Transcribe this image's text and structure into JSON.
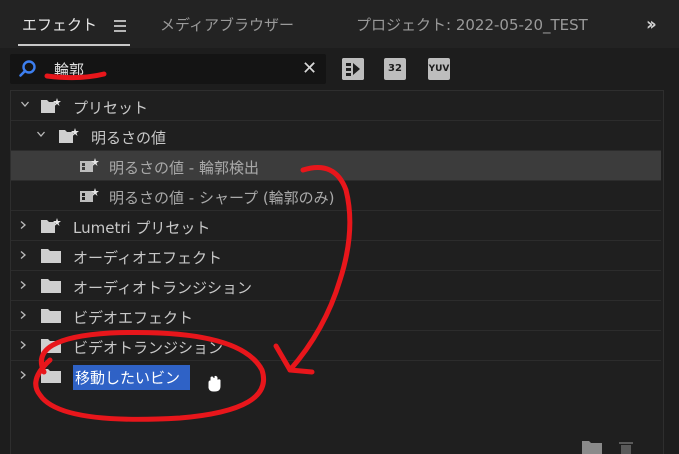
{
  "tabs": {
    "effects": "エフェクト",
    "media_browser": "メディアブラウザー",
    "project": "プロジェクト: 2022-05-20_TEST"
  },
  "search": {
    "value": "輪郭"
  },
  "toolbar": {
    "accelerated_label": "",
    "bit32_label": "32",
    "yuv_label": "YUV"
  },
  "tree": {
    "presets": "プリセット",
    "brightness_value": "明るさの値",
    "edge_detect": "明るさの値 - 輪郭検出",
    "sharpen": "明るさの値 - シャープ (輪郭のみ)",
    "lumetri_presets": "Lumetri プリセット",
    "audio_effects": "オーディオエフェクト",
    "audio_transitions": "オーディオトランジション",
    "video_effects": "ビデオエフェクト",
    "video_transitions": "ビデオトランジション",
    "new_bin": "移動したいビン"
  },
  "colors": {
    "annotation": "#e8161b",
    "selection": "#2f62c6"
  },
  "icons": {
    "search": "search-icon",
    "clear": "close-icon",
    "folder": "folder-icon",
    "preset_folder": "preset-folder-icon",
    "preset_item": "preset-effect-icon",
    "new_bin": "new-bin-icon",
    "delete": "trash-icon"
  }
}
